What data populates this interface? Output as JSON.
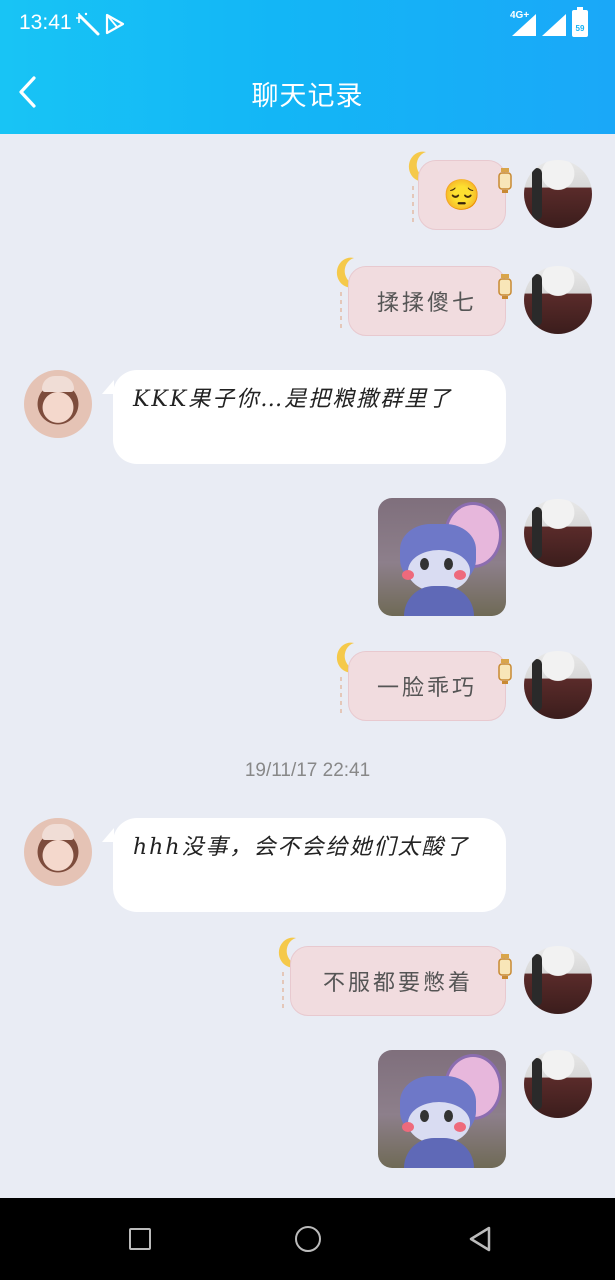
{
  "status_bar": {
    "time": "13:41",
    "network": "4G+",
    "battery": "59"
  },
  "header": {
    "title": "聊天记录"
  },
  "messages": [
    {
      "side": "right",
      "kind": "emoji",
      "text": "😔"
    },
    {
      "side": "right",
      "kind": "themed",
      "text": "揉揉傻七"
    },
    {
      "side": "left",
      "kind": "text",
      "text": "KKK果子你…是把粮撒群里了"
    },
    {
      "side": "right",
      "kind": "sticker",
      "text": ""
    },
    {
      "side": "right",
      "kind": "themed",
      "text": "一脸乖巧"
    },
    {
      "side": "left",
      "kind": "text",
      "text": "hhh没事，会不会给她们太酸了"
    },
    {
      "side": "right",
      "kind": "themed",
      "text": "不服都要憋着"
    },
    {
      "side": "right",
      "kind": "sticker",
      "text": ""
    }
  ],
  "timestamp": "19/11/17 22:41",
  "icons": {
    "back": "chevron-left-icon",
    "nav_recent": "square-icon",
    "nav_home": "circle-icon",
    "nav_back": "triangle-back-icon"
  },
  "colors": {
    "header": "#13b6f6",
    "chat_background": "#e9ecf4",
    "themed_bubble": "#f1dcdf",
    "white_bubble": "#ffffff"
  }
}
